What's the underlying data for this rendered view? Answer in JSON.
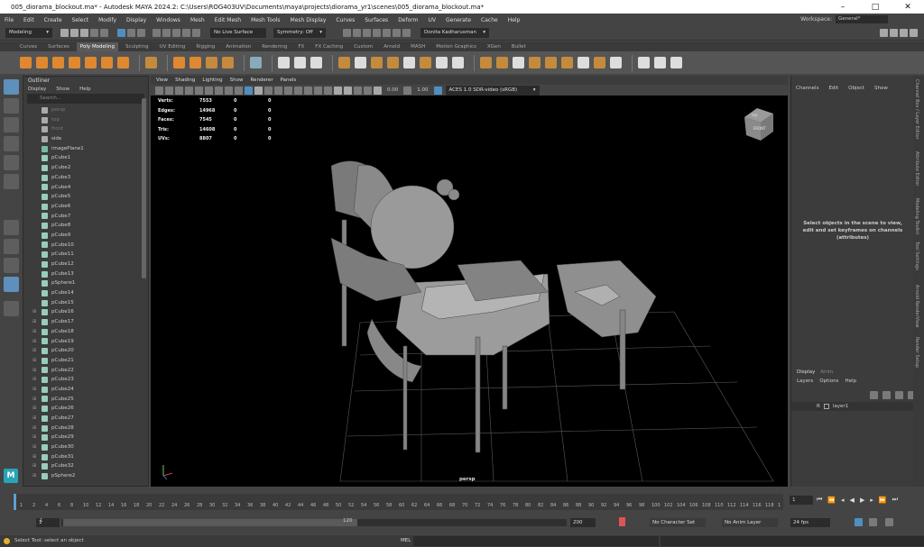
{
  "window": {
    "title": "005_diorama_blockout.ma* - Autodesk MAYA 2024.2: C:\\Users\\ROG403UV\\Documents\\maya\\projects\\diorama_yr1\\scenes\\005_diorama_blockout.ma*",
    "min": "–",
    "max": "□",
    "close": "✕"
  },
  "menu": {
    "items": [
      "File",
      "Edit",
      "Create",
      "Select",
      "Modify",
      "Display",
      "Windows",
      "Mesh",
      "Edit Mesh",
      "Mesh Tools",
      "Mesh Display",
      "Curves",
      "Surfaces",
      "Deform",
      "UV",
      "Generate",
      "Cache",
      "Help"
    ],
    "workspace_label": "Workspace:",
    "workspace_value": "General*"
  },
  "status": {
    "mode": "Modeling",
    "live": "No Live Surface",
    "symmetry": "Symmetry: Off",
    "user": "Donita Kadharusman"
  },
  "shelf": {
    "tabs": [
      "Curves",
      "Surfaces",
      "Poly Modeling",
      "Sculpting",
      "UV Editing",
      "Rigging",
      "Animation",
      "Rendering",
      "FX",
      "FX Caching",
      "Custom",
      "Arnold",
      "MASH",
      "Motion Graphics",
      "XGen",
      "Bullet"
    ],
    "active": "Poly Modeling"
  },
  "outliner": {
    "title": "Outliner",
    "menu": [
      "Display",
      "Show",
      "Help"
    ],
    "search_placeholder": "Search...",
    "items": [
      {
        "name": "persp",
        "kind": "cam",
        "dim": true
      },
      {
        "name": "top",
        "kind": "cam",
        "dim": true
      },
      {
        "name": "front",
        "kind": "cam",
        "dim": true
      },
      {
        "name": "side",
        "kind": "cam",
        "dim": false
      },
      {
        "name": "imagePlane1",
        "kind": "img",
        "dim": false
      },
      {
        "name": "pCube1",
        "kind": "mesh"
      },
      {
        "name": "pCube2",
        "kind": "mesh"
      },
      {
        "name": "pCube3",
        "kind": "mesh"
      },
      {
        "name": "pCube4",
        "kind": "mesh"
      },
      {
        "name": "pCube5",
        "kind": "mesh"
      },
      {
        "name": "pCube6",
        "kind": "mesh"
      },
      {
        "name": "pCube7",
        "kind": "mesh"
      },
      {
        "name": "pCube8",
        "kind": "mesh"
      },
      {
        "name": "pCube9",
        "kind": "mesh"
      },
      {
        "name": "pCube10",
        "kind": "mesh"
      },
      {
        "name": "pCube11",
        "kind": "mesh"
      },
      {
        "name": "pCube12",
        "kind": "mesh"
      },
      {
        "name": "pCube13",
        "kind": "mesh"
      },
      {
        "name": "pSphere1",
        "kind": "mesh"
      },
      {
        "name": "pCube14",
        "kind": "mesh"
      },
      {
        "name": "pCube15",
        "kind": "mesh"
      },
      {
        "name": "pCube16",
        "kind": "mesh",
        "exp": true
      },
      {
        "name": "pCube17",
        "kind": "mesh",
        "exp": true
      },
      {
        "name": "pCube18",
        "kind": "mesh",
        "exp": true
      },
      {
        "name": "pCube19",
        "kind": "mesh",
        "exp": true
      },
      {
        "name": "pCube20",
        "kind": "mesh",
        "exp": true
      },
      {
        "name": "pCube21",
        "kind": "mesh",
        "exp": true
      },
      {
        "name": "pCube22",
        "kind": "mesh",
        "exp": true
      },
      {
        "name": "pCube23",
        "kind": "mesh",
        "exp": true
      },
      {
        "name": "pCube24",
        "kind": "mesh",
        "exp": true
      },
      {
        "name": "pCube25",
        "kind": "mesh",
        "exp": true
      },
      {
        "name": "pCube26",
        "kind": "mesh",
        "exp": true
      },
      {
        "name": "pCube27",
        "kind": "mesh",
        "exp": true
      },
      {
        "name": "pCube28",
        "kind": "mesh",
        "exp": true
      },
      {
        "name": "pCube29",
        "kind": "mesh",
        "exp": true
      },
      {
        "name": "pCube30",
        "kind": "mesh",
        "exp": true
      },
      {
        "name": "pCube31",
        "kind": "mesh",
        "exp": true
      },
      {
        "name": "pCube32",
        "kind": "mesh",
        "exp": true
      },
      {
        "name": "pSphere2",
        "kind": "mesh",
        "exp": true
      }
    ]
  },
  "viewport": {
    "menu": [
      "View",
      "Shading",
      "Lighting",
      "Show",
      "Renderer",
      "Panels"
    ],
    "exposure": "0.00",
    "gamma": "1.00",
    "colorspace": "ACES 1.0 SDR-video (sRGB)",
    "camera": "persp",
    "cube_top": "top",
    "cube_front": "FRONT",
    "hud": [
      {
        "label": "Verts:",
        "a": "7553",
        "b": "0",
        "c": "0"
      },
      {
        "label": "Edges:",
        "a": "14968",
        "b": "0",
        "c": "0"
      },
      {
        "label": "Faces:",
        "a": "7545",
        "b": "0",
        "c": "0"
      },
      {
        "label": "Tris:",
        "a": "14608",
        "b": "0",
        "c": "0"
      },
      {
        "label": "UVs:",
        "a": "8807",
        "b": "0",
        "c": "0"
      }
    ]
  },
  "channelbox": {
    "menu": [
      "Channels",
      "Edit",
      "Object",
      "Show"
    ],
    "message": "Select objects in the scene to view, edit and set keyframes on channels (attributes)"
  },
  "layers": {
    "tabs": [
      "Display",
      "Anim"
    ],
    "menu": [
      "Layers",
      "Options",
      "Help"
    ],
    "layer_name": "layer1",
    "layer_r": "R"
  },
  "sidetabs": [
    "Channel Box / Layer Editor",
    "Attribute Editor",
    "Modeling Toolkit",
    "Tool Settings",
    "Arnold RenderView",
    "Render Setup"
  ],
  "time": {
    "ticks": [
      "1",
      "2",
      "4",
      "6",
      "8",
      "10",
      "12",
      "14",
      "16",
      "18",
      "20",
      "22",
      "24",
      "26",
      "28",
      "30",
      "32",
      "34",
      "36",
      "38",
      "40",
      "42",
      "44",
      "46",
      "48",
      "50",
      "52",
      "54",
      "56",
      "58",
      "60",
      "62",
      "64",
      "66",
      "68",
      "70",
      "72",
      "74",
      "76",
      "78",
      "80",
      "82",
      "84",
      "86",
      "88",
      "90",
      "92",
      "94",
      "96",
      "98",
      "100",
      "102",
      "104",
      "106",
      "108",
      "110",
      "112",
      "114",
      "116",
      "118",
      "1"
    ],
    "current": "1"
  },
  "range": {
    "start": "1",
    "inner_start": "1",
    "inner_end": "120",
    "end": "200",
    "character": "No Character Set",
    "anim_layer": "No Anim Layer",
    "fps": "24 fps"
  },
  "footer": {
    "help": "Select Tool: select an object",
    "mel": "MEL"
  }
}
